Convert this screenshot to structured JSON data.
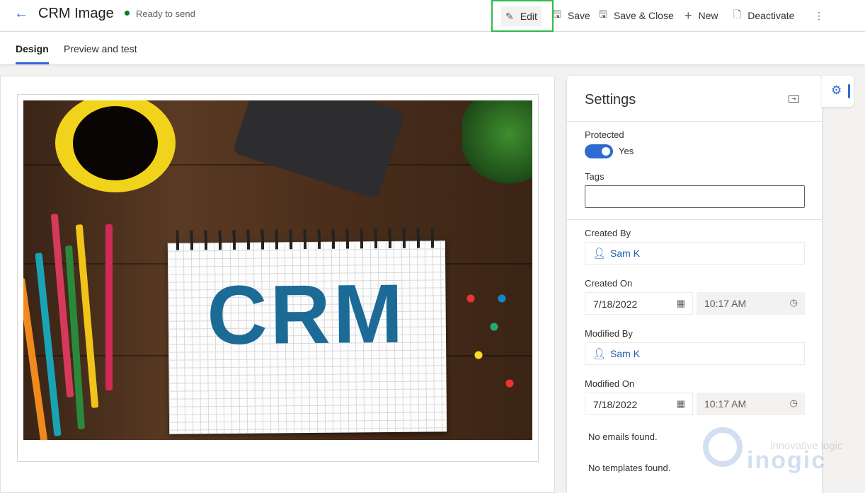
{
  "header": {
    "title": "CRM Image",
    "status": "Ready to send",
    "status_color": "#107c10"
  },
  "commands": [
    {
      "label": "Edit",
      "icon": "pencil-icon"
    },
    {
      "label": "Save",
      "icon": "save-icon"
    },
    {
      "label": "Save & Close",
      "icon": "save-close-icon"
    },
    {
      "label": "New",
      "icon": "plus-icon"
    },
    {
      "label": "Deactivate",
      "icon": "deactivate-icon"
    }
  ],
  "tabs": [
    {
      "label": "Design",
      "active": true
    },
    {
      "label": "Preview and test",
      "active": false
    }
  ],
  "image": {
    "lettering": "CRM"
  },
  "settings": {
    "title": "Settings",
    "protected_label": "Protected",
    "protected_value": "Yes",
    "protected_on": true,
    "tags_label": "Tags",
    "tags_value": "",
    "created_by_label": "Created By",
    "created_by": "Sam K",
    "created_on_label": "Created On",
    "created_on_date": "7/18/2022",
    "created_on_time": "10:17 AM",
    "modified_by_label": "Modified By",
    "modified_by": "Sam K",
    "modified_on_label": "Modified On",
    "modified_on_date": "7/18/2022",
    "modified_on_time": "10:17 AM",
    "no_emails": "No emails found.",
    "no_templates": "No templates found."
  },
  "watermark": {
    "tagline": "innovative logic",
    "brand": "inogic"
  },
  "accent": "#2f6ad2"
}
